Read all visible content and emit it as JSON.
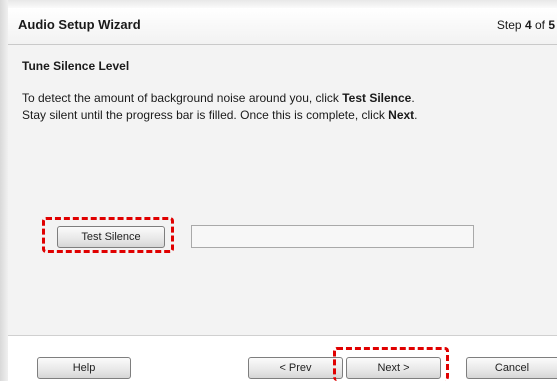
{
  "wizard": {
    "title": "Audio Setup Wizard",
    "step_prefix": "Step ",
    "step_current": "4",
    "step_sep": " of ",
    "step_total": "5"
  },
  "section": {
    "heading": "Tune Silence Level"
  },
  "instructions": {
    "line1_a": "To detect the amount of background noise around you, click ",
    "line1_b": "Test Silence",
    "line1_c": ".",
    "line2_a": "Stay silent until the progress bar is filled. Once this is complete, click ",
    "line2_b": "Next",
    "line2_c": "."
  },
  "controls": {
    "test_silence_label": "Test Silence",
    "progress_value": 0
  },
  "footer": {
    "help_label": "Help",
    "prev_label": "< Prev",
    "next_label": "Next >",
    "cancel_label": "Cancel"
  },
  "annotations": {
    "highlight_color": "#e00000"
  }
}
